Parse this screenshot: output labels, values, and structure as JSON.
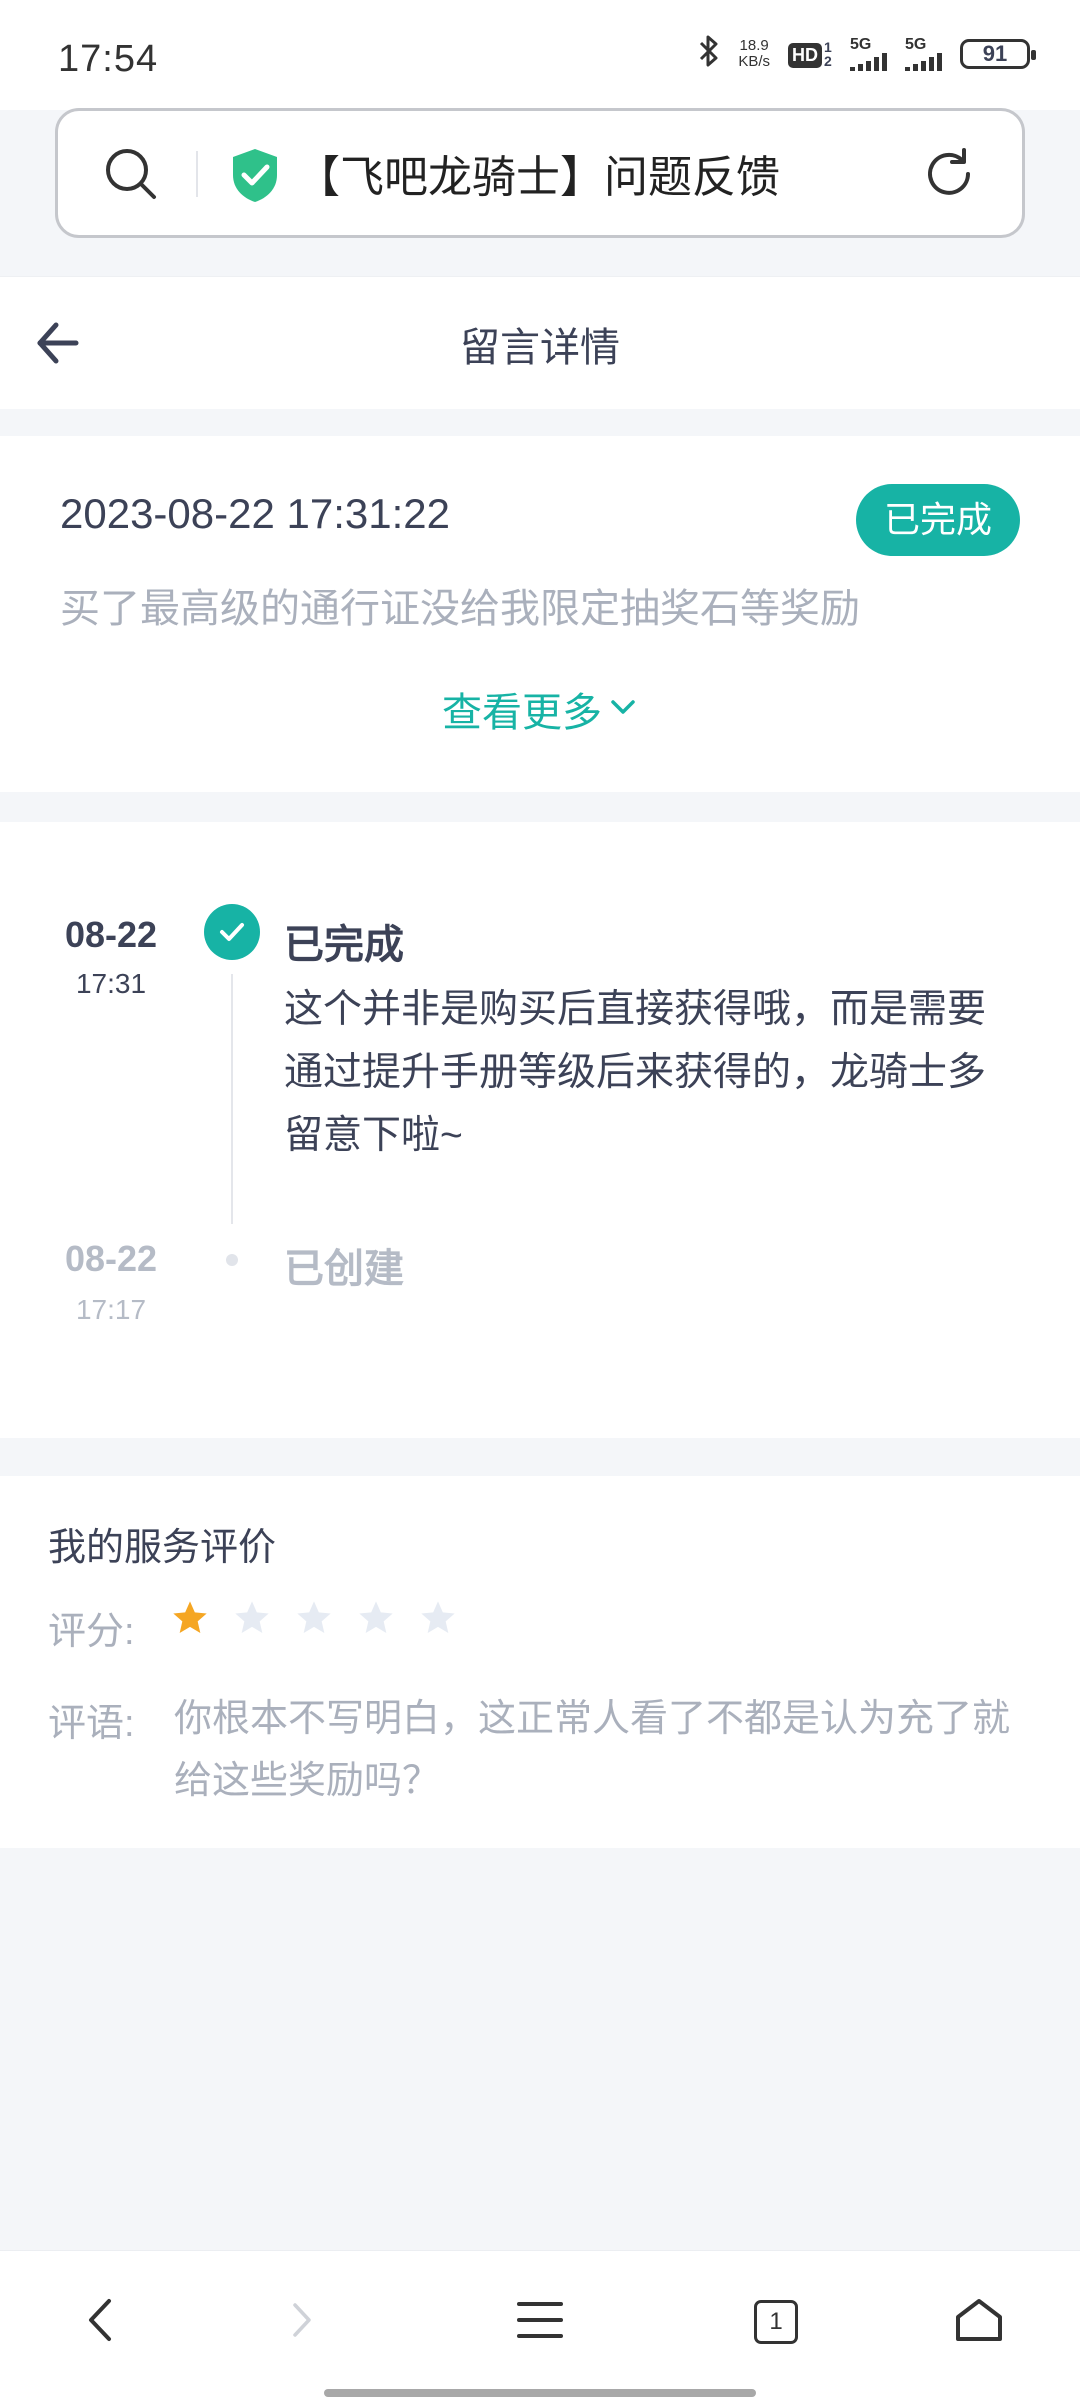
{
  "status_bar": {
    "time": "17:54",
    "net_speed_value": "18.9",
    "net_speed_unit": "KB/s",
    "hd_label": "HD",
    "hd_sub": "12",
    "sim1_label": "5G",
    "sim2_label": "5G",
    "battery": "91"
  },
  "address_bar": {
    "title": "【飞吧龙骑士】问题反馈",
    "shield_color": "#2fc18a"
  },
  "header": {
    "title": "留言详情"
  },
  "ticket": {
    "datetime": "2023-08-22 17:31:22",
    "status_badge": "已完成",
    "description": "买了最高级的通行证没给我限定抽奖石等奖励",
    "see_more": "查看更多"
  },
  "timeline": [
    {
      "date": "08-22",
      "time": "17:31",
      "status": "已完成",
      "reply": "这个并非是购买后直接获得哦，而是需要通过提升手册等级后来获得的，龙骑士多留意下啦~"
    },
    {
      "date": "08-22",
      "time": "17:17",
      "status": "已创建"
    }
  ],
  "rating": {
    "title": "我的服务评价",
    "score_label": "评分:",
    "stars_filled": 1,
    "stars_total": 5,
    "comment_label": "评语:",
    "comment": "你根本不写明白，这正常人看了不都是认为充了就给这些奖励吗？"
  },
  "bottom_nav": {
    "tab_count": "1"
  },
  "colors": {
    "accent": "#17b3a5",
    "star_filled": "#f5a623",
    "star_empty": "#e6ebf3",
    "muted_text": "#aab0bc",
    "page_bg": "#f4f6f9"
  }
}
